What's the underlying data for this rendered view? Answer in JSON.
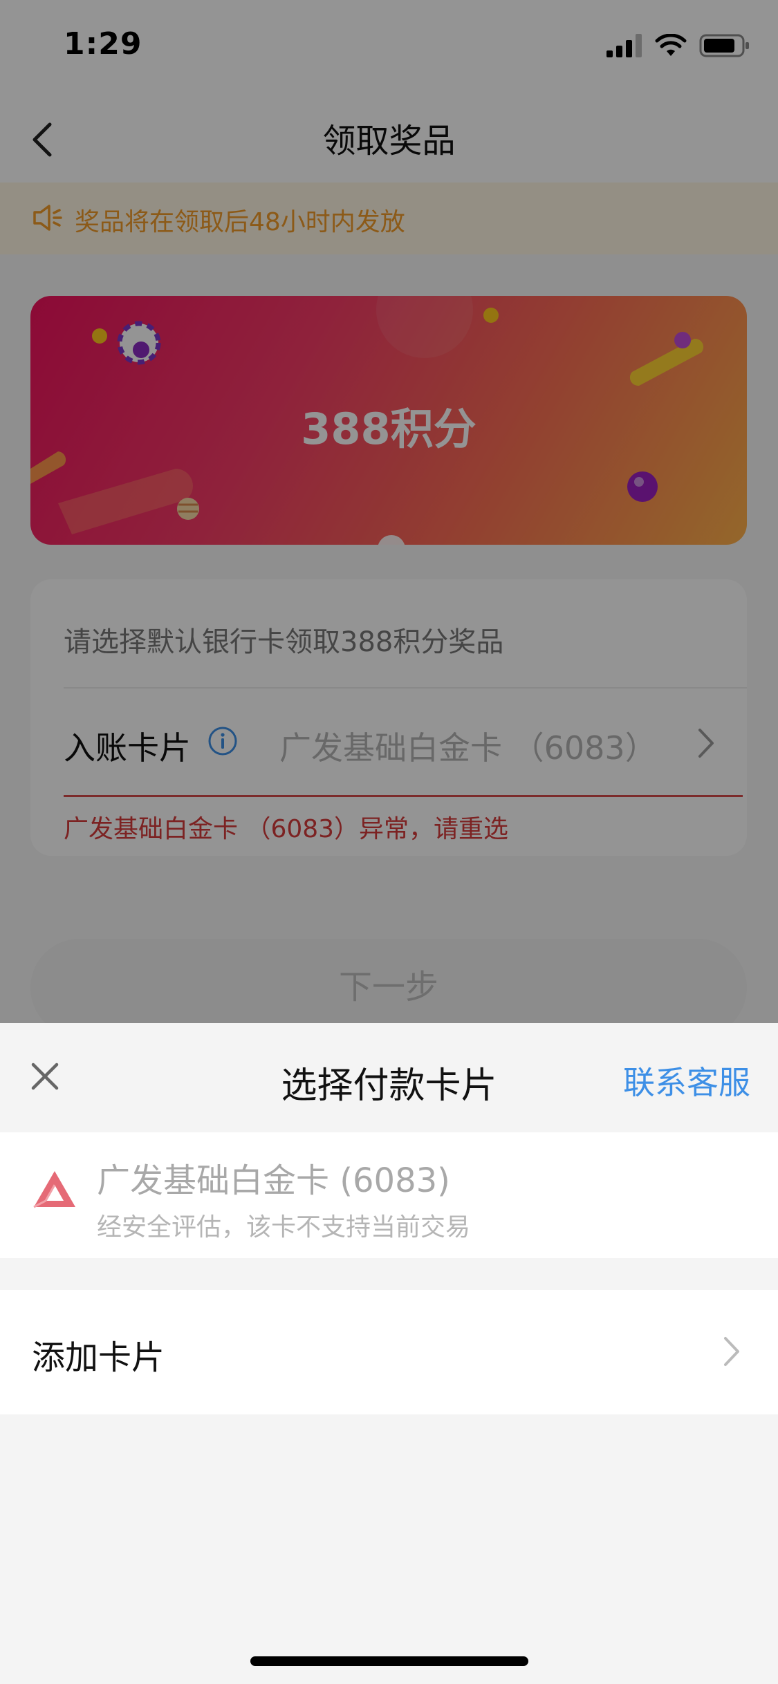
{
  "status": {
    "time": "1:29"
  },
  "nav": {
    "title": "领取奖品"
  },
  "notice": {
    "text": "奖品将在领取后48小时内发放"
  },
  "banner": {
    "title": "388积分"
  },
  "form": {
    "description": "请选择默认银行卡领取388积分奖品",
    "label": "入账卡片",
    "value": "广发基础白金卡 （6083）",
    "error": "广发基础白金卡 （6083）异常，请重选"
  },
  "next_button": {
    "label": "下一步"
  },
  "sheet": {
    "title": "选择付款卡片",
    "help_link": "联系客服",
    "card": {
      "name": "广发基础白金卡 (6083)",
      "note": "经安全评估，该卡不支持当前交易"
    },
    "add_card": "添加卡片"
  },
  "colors": {
    "accent_blue": "#3d8fe6",
    "error_red": "#d63b3b",
    "notice_orange": "#f29b2a",
    "bank_logo_red": "#e0505e"
  },
  "icons": [
    "back-arrow-icon",
    "speaker-icon",
    "info-icon",
    "chevron-right-icon",
    "close-icon",
    "bank-logo-icon",
    "signal-icon",
    "wifi-icon",
    "battery-icon"
  ]
}
